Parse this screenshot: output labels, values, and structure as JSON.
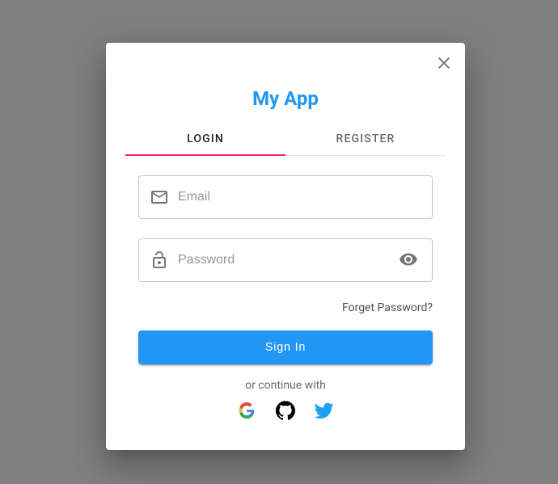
{
  "header": {
    "app_title": "My App"
  },
  "tabs": {
    "login_label": "LOGIN",
    "register_label": "REGISTER",
    "active": "login"
  },
  "form": {
    "email": {
      "placeholder": "Email",
      "value": ""
    },
    "password": {
      "placeholder": "Password",
      "value": ""
    },
    "forgot_label": "Forget Password?",
    "signin_label": "Sign In",
    "divider_text": "or continue with"
  },
  "social": {
    "google": "google-icon",
    "github": "github-icon",
    "twitter": "twitter-icon"
  },
  "colors": {
    "primary": "#2196F3",
    "secondary": "#E91E63"
  }
}
